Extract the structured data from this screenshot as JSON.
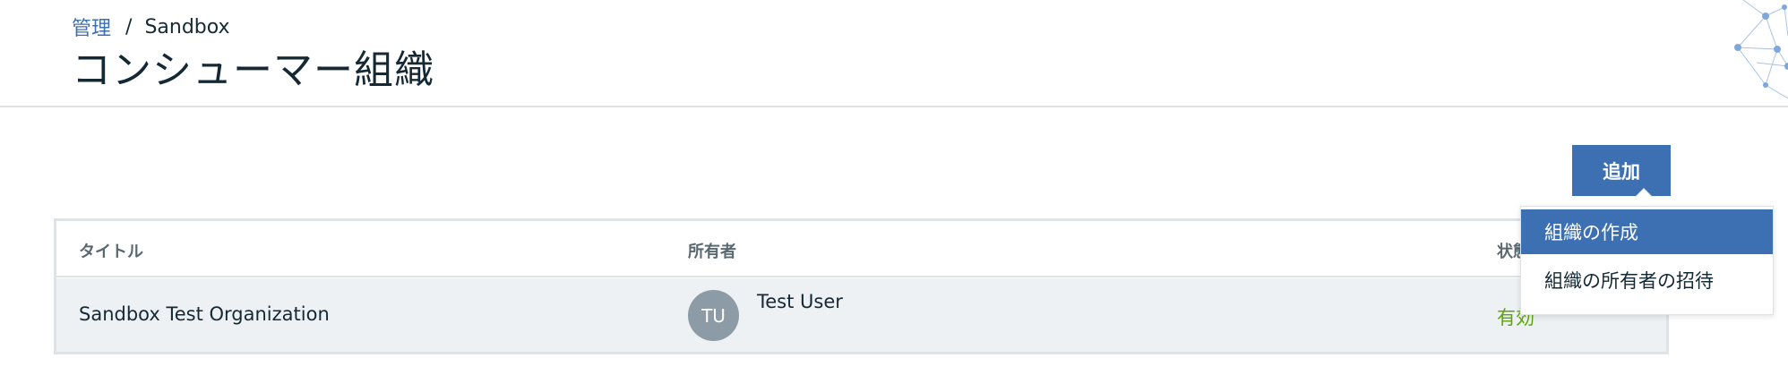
{
  "breadcrumb": {
    "parent": "管理",
    "separator": "/",
    "current": "Sandbox"
  },
  "page": {
    "title": "コンシューマー組織"
  },
  "toolbar": {
    "add_label": "追加"
  },
  "add_menu": {
    "items": [
      {
        "label": "組織の作成",
        "highlighted": true
      },
      {
        "label": "組織の所有者の招待",
        "highlighted": false
      }
    ]
  },
  "table": {
    "columns": [
      "タイトル",
      "所有者",
      "状態"
    ],
    "rows": [
      {
        "title": "Sandbox Test Organization",
        "owner_initials": "TU",
        "owner_name": "Test User",
        "status": "有効"
      }
    ]
  },
  "colors": {
    "primary": "#3d70b2",
    "status_active": "#5aa700",
    "avatar": "#8c9ba5"
  }
}
